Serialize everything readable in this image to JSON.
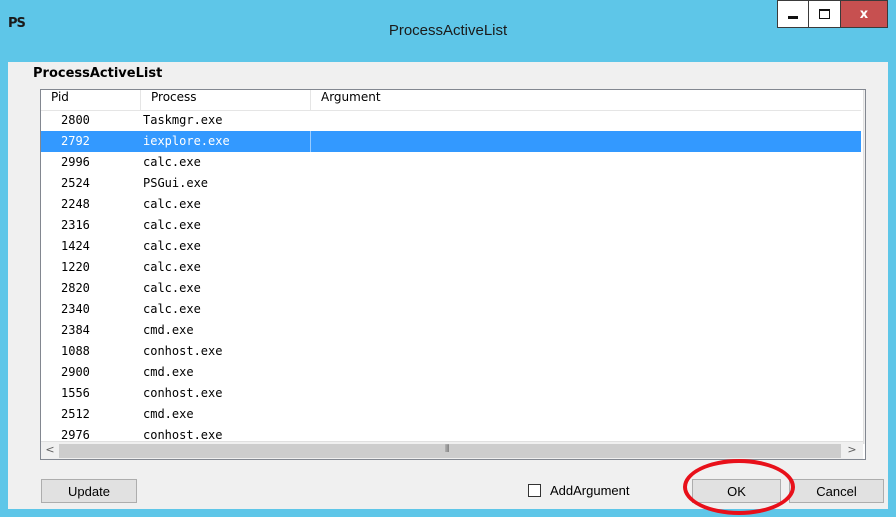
{
  "window": {
    "title": "ProcessActiveList",
    "app_icon_text": "PS",
    "close_glyph": "x"
  },
  "group": {
    "label": "ProcessActiveList"
  },
  "list": {
    "columns": [
      "Pid",
      "Process",
      "Argument"
    ],
    "selected_index": 1,
    "selection_color": "#3399ff",
    "rows": [
      {
        "pid": "2800",
        "process": "Taskmgr.exe"
      },
      {
        "pid": "2792",
        "process": "iexplore.exe"
      },
      {
        "pid": "2996",
        "process": "calc.exe"
      },
      {
        "pid": "2524",
        "process": "PSGui.exe"
      },
      {
        "pid": "2248",
        "process": "calc.exe"
      },
      {
        "pid": "2316",
        "process": "calc.exe"
      },
      {
        "pid": "1424",
        "process": "calc.exe"
      },
      {
        "pid": "1220",
        "process": "calc.exe"
      },
      {
        "pid": "2820",
        "process": "calc.exe"
      },
      {
        "pid": "2340",
        "process": "calc.exe"
      },
      {
        "pid": "2384",
        "process": "cmd.exe"
      },
      {
        "pid": "1088",
        "process": "conhost.exe"
      },
      {
        "pid": "2900",
        "process": "cmd.exe"
      },
      {
        "pid": "1556",
        "process": "conhost.exe"
      },
      {
        "pid": "2512",
        "process": "cmd.exe"
      },
      {
        "pid": "2976",
        "process": "conhost.exe"
      }
    ]
  },
  "buttons": {
    "update": "Update",
    "ok": "OK",
    "cancel": "Cancel"
  },
  "add_argument": {
    "label": "AddArgument",
    "checked": false
  },
  "colors": {
    "title_bar": "#5ec6e8",
    "close_button": "#c75050",
    "annotation_ring": "#e8101a"
  }
}
